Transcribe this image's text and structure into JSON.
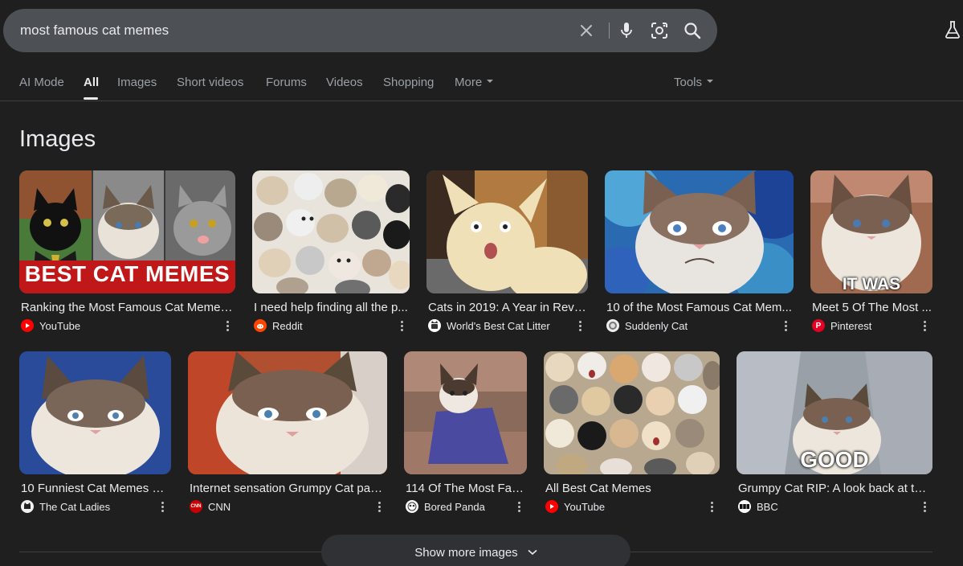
{
  "search": {
    "query": "most famous cat memes"
  },
  "icons": {
    "clear": "close-icon",
    "voice": "microphone-icon",
    "lens": "lens-camera-icon",
    "search": "search-icon",
    "labs": "labs-flask-icon"
  },
  "tabs": [
    {
      "label": "AI Mode"
    },
    {
      "label": "All",
      "active": true
    },
    {
      "label": "Images"
    },
    {
      "label": "Short videos"
    },
    {
      "label": "Forums"
    },
    {
      "label": "Videos"
    },
    {
      "label": "Shopping"
    },
    {
      "label": "More"
    },
    {
      "label": "Tools"
    }
  ],
  "section": {
    "title": "Images"
  },
  "images": [
    {
      "title": "Ranking the Most Famous Cat Memes ...",
      "source": "YouTube",
      "favicon": "youtube-icon",
      "overlay": "BEST CAT MEMES"
    },
    {
      "title": "I need help finding all the p...",
      "source": "Reddit",
      "favicon": "reddit-icon"
    },
    {
      "title": "Cats in 2019: A Year in Revie...",
      "source": "World's Best Cat Litter",
      "favicon": "worlds-best-cat-litter-icon"
    },
    {
      "title": "10 of the Most Famous Cat Mem...",
      "source": "Suddenly Cat",
      "favicon": "suddenly-cat-icon"
    },
    {
      "title": "Meet 5 Of The Most ...",
      "source": "Pinterest",
      "favicon": "pinterest-icon",
      "overlay": "IT WAS AWFUL"
    },
    {
      "title": "10 Funniest Cat Memes of ...",
      "source": "The Cat Ladies",
      "favicon": "cat-ladies-icon"
    },
    {
      "title": "Internet sensation Grumpy Cat pas...",
      "source": "CNN",
      "favicon": "cnn-icon",
      "favicon_text": "CNN"
    },
    {
      "title": "114 Of The Most Fam...",
      "source": "Bored Panda",
      "favicon": "bored-panda-icon"
    },
    {
      "title": "All Best Cat Memes",
      "source": "YouTube",
      "favicon": "youtube-icon"
    },
    {
      "title": "Grumpy Cat RIP: A look back at the...",
      "source": "BBC",
      "favicon": "bbc-icon",
      "overlay": "GOOD"
    }
  ],
  "show_more": {
    "label": "Show more images"
  },
  "colors": {
    "background": "#1f1f1f",
    "search_bar": "#4d5156",
    "youtube": "#ff0000",
    "reddit": "#ff4500",
    "pinterest": "#e60023",
    "cnn": "#cc0000"
  }
}
